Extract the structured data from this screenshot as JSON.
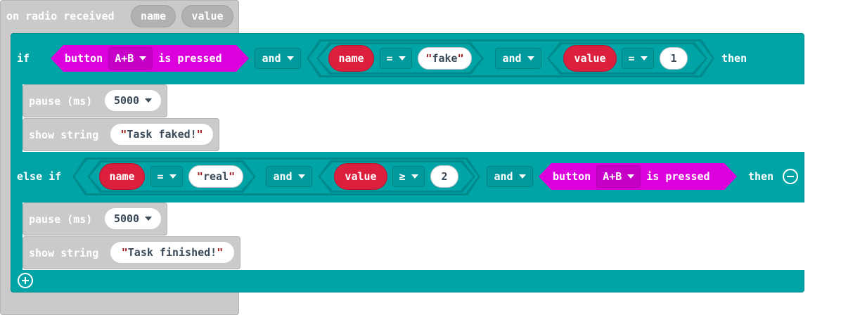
{
  "event": {
    "label": "on radio received",
    "params": [
      "name",
      "value"
    ]
  },
  "if_block": {
    "if_label": "if",
    "then_label": "then",
    "cond1": {
      "prefix": "button",
      "button": "A+B",
      "suffix": "is pressed"
    },
    "and1": "and",
    "cmp1": {
      "var": "name",
      "op": "=",
      "value": "fake"
    },
    "and2": "and",
    "cmp2": {
      "var": "value",
      "op": "=",
      "value": "1"
    },
    "pause": {
      "label": "pause (ms)",
      "value": "5000"
    },
    "show": {
      "label": "show string",
      "value": "Task faked!"
    }
  },
  "elseif_block": {
    "label": "else if",
    "then_label": "then",
    "cmp1": {
      "var": "name",
      "op": "=",
      "value": "real"
    },
    "and1": "and",
    "cmp2": {
      "var": "value",
      "op": "≥",
      "value": "2"
    },
    "and2": "and",
    "cond": {
      "prefix": "button",
      "button": "A+B",
      "suffix": "is pressed"
    },
    "pause": {
      "label": "pause (ms)",
      "value": "5000"
    },
    "show": {
      "label": "show string",
      "value": "Task finished!"
    }
  },
  "quote_char": "\"",
  "colors": {
    "teal": "#00a4a6",
    "gray": "#cacaca",
    "pink": "#dc00dc",
    "red": "#dc1f3c"
  },
  "icons": {
    "remove": "minus-circle-icon",
    "add": "plus-circle-icon",
    "dropdown": "caret-down-icon"
  }
}
